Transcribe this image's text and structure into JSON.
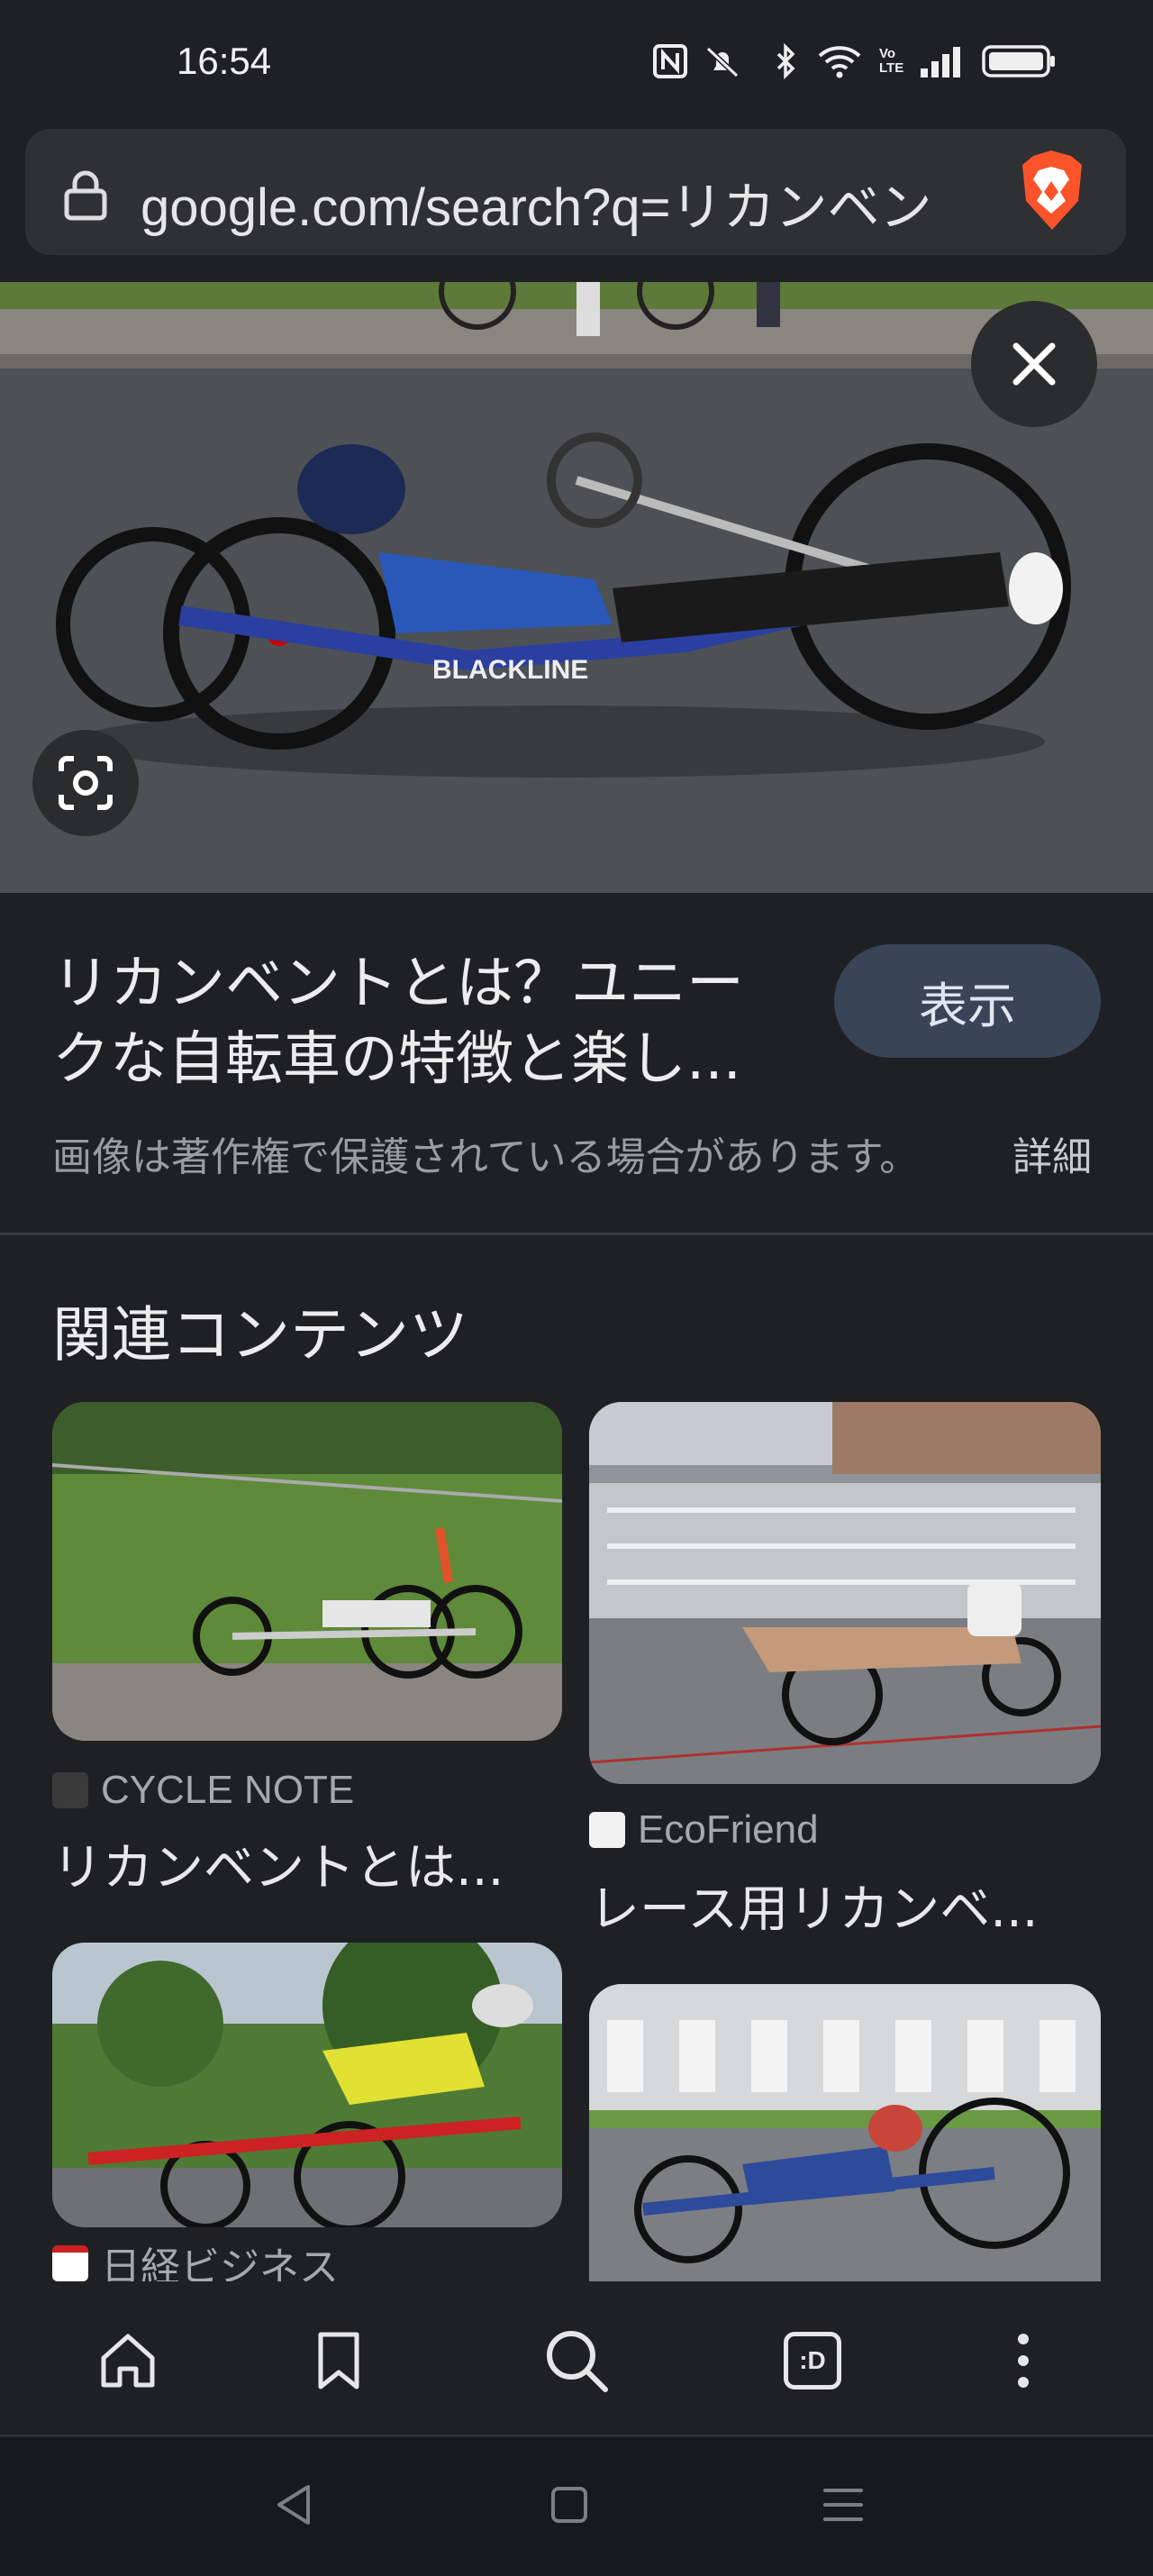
{
  "status_bar": {
    "time": "16:54",
    "icons": [
      "nfc-icon",
      "mute-icon",
      "bluetooth-icon",
      "wifi-icon",
      "volte-icon",
      "signal-icon",
      "battery-icon"
    ],
    "volte_label": "Vo\nLTE"
  },
  "address_bar": {
    "url": "google.com/search?q=リカンベン",
    "icons": [
      "lock-icon",
      "brave-logo-icon"
    ]
  },
  "hero_image": {
    "description_icon": "recumbent-handcycle-photo",
    "bike_brand_text": "BLACKLINE"
  },
  "result": {
    "title": "リカンベントとは？ユニークな自転車の特徴と楽し...",
    "view_button": "表示",
    "copyright_notice": "画像は著作権で保護されている場合があります。",
    "details_link": "詳細"
  },
  "related": {
    "heading": "関連コンテンツ",
    "items": [
      {
        "source": "CYCLE NOTE",
        "title": "リカンベントとは..."
      },
      {
        "source": "EcoFriend",
        "title": "レース用リカンベ..."
      },
      {
        "source": "日経ビジネス",
        "title": ""
      },
      {
        "source": "",
        "title": ""
      }
    ]
  },
  "toolbar": {
    "buttons": [
      "home-icon",
      "bookmark-icon",
      "search-icon",
      "tabs-icon",
      "more-icon"
    ],
    "tabs_label": ":D"
  },
  "nav_bar": {
    "buttons": [
      "back-icon",
      "home-square-icon",
      "recents-icon"
    ]
  },
  "colors": {
    "background": "#1f2024",
    "url_bar": "#2e3033",
    "view_button": "#394457",
    "brave_orange": "#fb542b"
  }
}
